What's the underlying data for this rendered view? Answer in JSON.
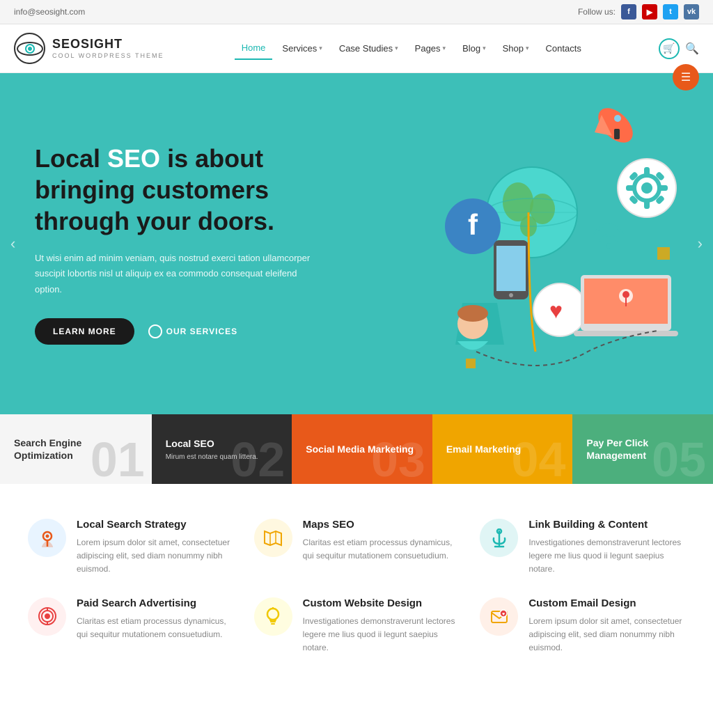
{
  "topbar": {
    "email": "info@seosight.com",
    "follow_label": "Follow us:"
  },
  "header": {
    "logo_title": "SEOSIGHT",
    "logo_sub": "COOL WORDPRESS THEME",
    "nav": [
      {
        "label": "Home",
        "active": true,
        "has_arrow": false
      },
      {
        "label": "Services",
        "active": false,
        "has_arrow": true
      },
      {
        "label": "Case Studies",
        "active": false,
        "has_arrow": true
      },
      {
        "label": "Pages",
        "active": false,
        "has_arrow": true
      },
      {
        "label": "Blog",
        "active": false,
        "has_arrow": true
      },
      {
        "label": "Shop",
        "active": false,
        "has_arrow": true
      },
      {
        "label": "Contacts",
        "active": false,
        "has_arrow": false
      }
    ]
  },
  "hero": {
    "title_pre": "Local ",
    "title_highlight": "SEO",
    "title_post": " is about bringing customers through your doors.",
    "description": "Ut wisi enim ad minim veniam, quis nostrud exerci tation ullamcorper suscipit lobortis nisl ut aliquip ex ea commodo consequat eleifend option.",
    "btn_learn": "LEARN MORE",
    "btn_services": "OUR SERVICES"
  },
  "services_bar": [
    {
      "title": "Search Engine Optimization",
      "subtitle": "",
      "num": "01",
      "dark": false
    },
    {
      "title": "Local SEO",
      "subtitle": "Mirum est notare quam littera.",
      "num": "02",
      "dark": true
    },
    {
      "title": "Social Media Marketing",
      "subtitle": "",
      "num": "03",
      "dark": false
    },
    {
      "title": "Email Marketing",
      "subtitle": "",
      "num": "04",
      "dark": false
    },
    {
      "title": "Pay Per Click Management",
      "subtitle": "",
      "num": "05",
      "dark": false
    }
  ],
  "service_cards": [
    {
      "icon": "location",
      "title": "Local Search Strategy",
      "desc": "Lorem ipsum dolor sit amet, consectetuer adipiscing elit, sed diam nonummy nibh euismod."
    },
    {
      "icon": "map",
      "title": "Maps SEO",
      "desc": "Claritas est etiam processus dynamicus, qui sequitur mutationem consuetudium."
    },
    {
      "icon": "anchor",
      "title": "Link Building & Content",
      "desc": "Investigationes demonstraverunt lectores legere me lius quod ii legunt saepius notare."
    },
    {
      "icon": "target",
      "title": "Paid Search Advertising",
      "desc": "Claritas est etiam processus dynamicus, qui sequitur mutationem consuetudium."
    },
    {
      "icon": "bulb",
      "title": "Custom Website Design",
      "desc": "Investigationes demonstraverunt lectores legere me lius quod ii legunt saepius notare."
    },
    {
      "icon": "mail",
      "title": "Custom Email Design",
      "desc": "Lorem ipsum dolor sit amet, consectetuer adipiscing elit, sed diam nonummy nibh euismod."
    }
  ]
}
